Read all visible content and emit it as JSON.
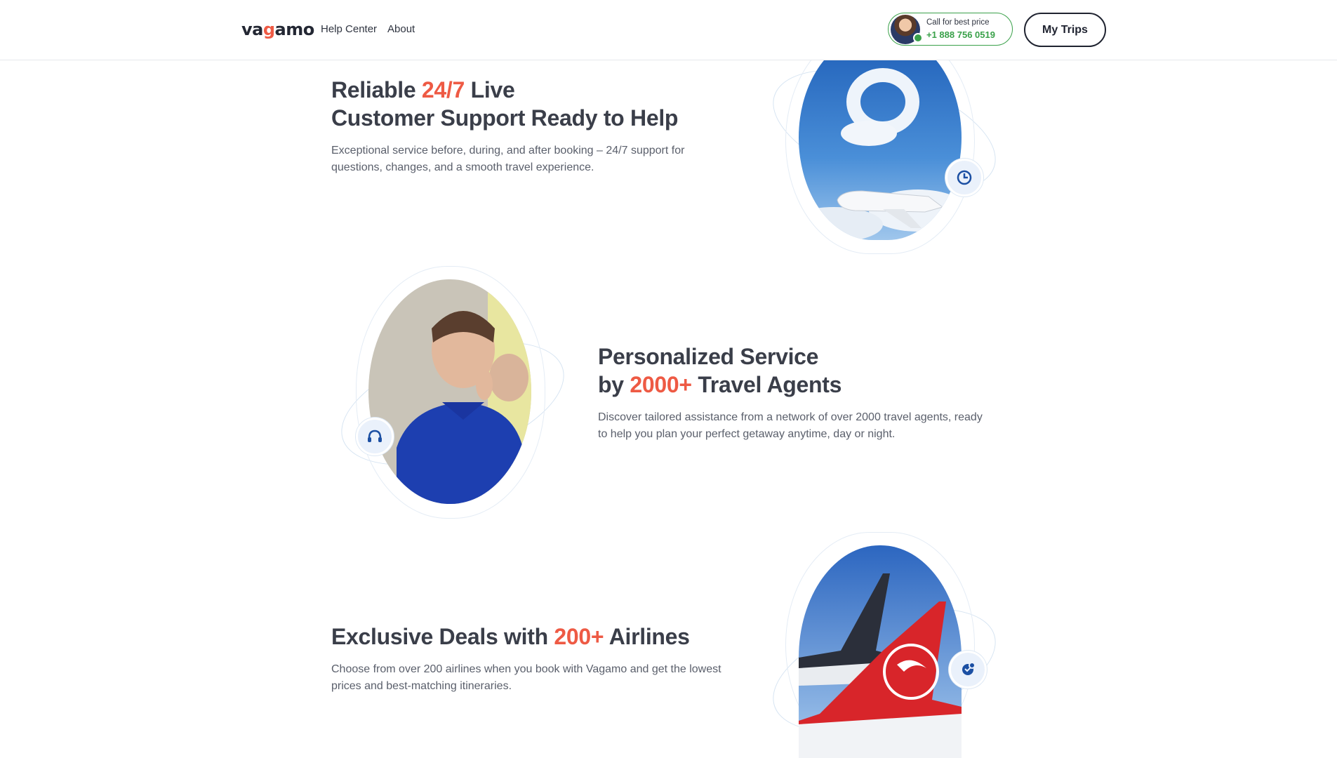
{
  "header": {
    "logo_pre": "va",
    "logo_accent": "g",
    "logo_post": "amo",
    "nav": [
      {
        "label": "Help Center"
      },
      {
        "label": "About"
      }
    ],
    "call": {
      "label": "Call for best price",
      "number": "+1 888 756 0519"
    },
    "trips_button": "My Trips"
  },
  "features": [
    {
      "title_pre": "Reliable ",
      "title_highlight": "24/7",
      "title_post": " Live",
      "title_line2": "Customer Support Ready to Help",
      "description_line1": "Exceptional service before, during, and after booking – 24/7 support for",
      "description_line2": "questions, changes, and a smooth travel experience.",
      "badge_icon": "support-refresh-icon"
    },
    {
      "title_line1": "Personalized Service",
      "title_pre": "by ",
      "title_highlight": "2000+",
      "title_post": " Travel Agents",
      "description_line1": "Discover tailored assistance from a network of over 2000 travel agents, ready",
      "description_line2": "to help you plan your perfect getaway anytime, day or night.",
      "badge_icon": "headset-icon"
    },
    {
      "title_pre": "Exclusive Deals with ",
      "title_highlight": "200+",
      "title_post": " Airlines",
      "description_line1": "Choose from over 200 airlines when you book with Vagamo and get the lowest",
      "description_line2": "prices and best-matching itineraries.",
      "badge_icon": "globe-deal-icon"
    }
  ],
  "colors": {
    "accent": "#ee5a44",
    "call_green": "#3aa14a",
    "badge_bg": "#eaf1fb",
    "icon_blue": "#1b4fa3"
  }
}
